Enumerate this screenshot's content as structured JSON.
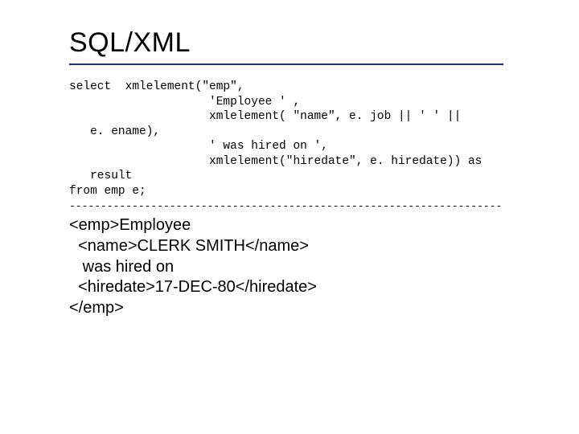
{
  "title": "SQL/XML",
  "code": {
    "l1": "select  xmlelement(\"emp\",",
    "l2": "                    'Employee ' ,",
    "l3": "                    xmlelement( \"name\", e. job || ' ' || ",
    "l4": "   e. ename),",
    "l5": "                    ' was hired on ',",
    "l6": "                    xmlelement(\"hiredate\", e. hiredate)) as ",
    "l7": "   result",
    "l8": "from emp e;"
  },
  "separator": "--------------------------------------------------------------------------------------------",
  "output": {
    "l1": "<emp>Employee",
    "l2": "  <name>CLERK SMITH</name>",
    "l3": "   was hired on",
    "l4": "  <hiredate>17-DEC-80</hiredate>",
    "l5": "</emp>"
  }
}
